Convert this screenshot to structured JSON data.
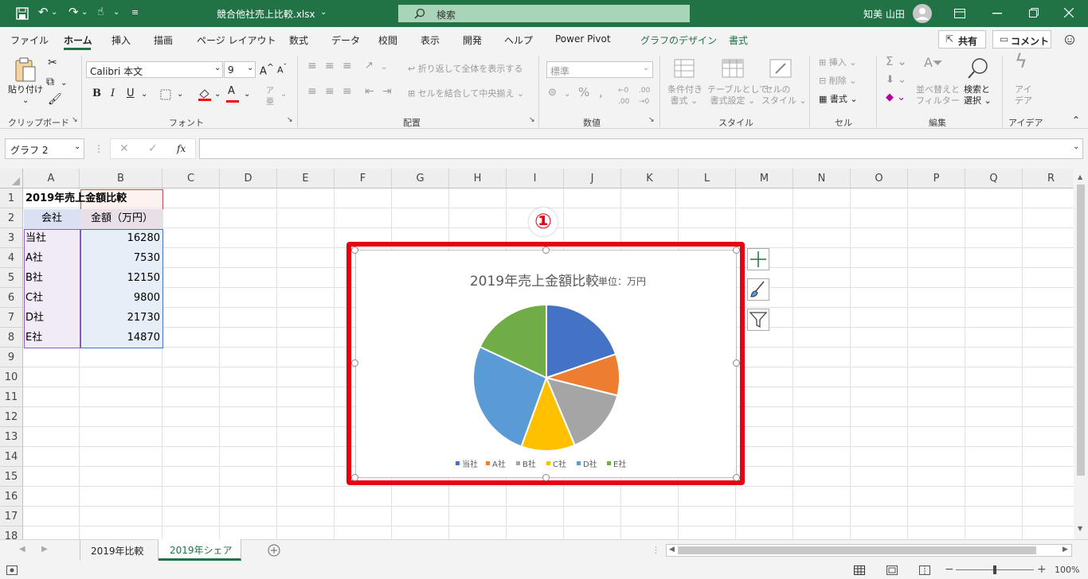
{
  "window": {
    "filename": "競合他社売上比較.xlsx",
    "search_placeholder": "検索",
    "user_name": "知美 山田"
  },
  "menu": {
    "tabs": [
      "ファイル",
      "ホーム",
      "挿入",
      "描画",
      "ページ レイアウト",
      "数式",
      "データ",
      "校閲",
      "表示",
      "開発",
      "ヘルプ",
      "Power Pivot",
      "グラフのデザイン",
      "書式"
    ],
    "share": "共有",
    "comment": "コメント"
  },
  "ribbon": {
    "paste": "貼り付け",
    "font_name": "Calibri 本文",
    "font_size": "9",
    "wrap_text": "折り返して全体を表示する",
    "merge_center": "セルを結合して中央揃え",
    "number_format": "標準",
    "cond_format": [
      "条件付き",
      "書式"
    ],
    "table_format": [
      "テーブルとして",
      "書式設定"
    ],
    "cell_style": [
      "セルの",
      "スタイル"
    ],
    "insert": "挿入",
    "delete": "削除",
    "format": "書式",
    "sort_filter": [
      "並べ替えと",
      "フィルター"
    ],
    "find_select": [
      "検索と",
      "選択"
    ],
    "ideas": [
      "アイ",
      "デア"
    ],
    "groups": {
      "clipboard": "クリップボード",
      "font": "フォント",
      "alignment": "配置",
      "number": "数値",
      "styles": "スタイル",
      "cells": "セル",
      "editing": "編集",
      "ideas": "アイデア"
    }
  },
  "formula_bar": {
    "name_box": "グラフ 2",
    "fx": "fx",
    "formula": ""
  },
  "columns": [
    "A",
    "B",
    "C",
    "D",
    "E",
    "F",
    "G",
    "H",
    "I",
    "J",
    "K",
    "L",
    "M",
    "N",
    "O",
    "P",
    "Q",
    "R"
  ],
  "rows": [
    "1",
    "2",
    "3",
    "4",
    "5",
    "6",
    "7",
    "8",
    "9",
    "10",
    "11",
    "12",
    "13",
    "14",
    "15",
    "16",
    "17",
    "18"
  ],
  "table": {
    "title": "2019年売上金額比較",
    "headers": [
      "会社",
      "金額（万円）"
    ],
    "rows": [
      [
        "当社",
        "16280"
      ],
      [
        "A社",
        "7530"
      ],
      [
        "B社",
        "12150"
      ],
      [
        "C社",
        "9800"
      ],
      [
        "D社",
        "21730"
      ],
      [
        "E社",
        "14870"
      ]
    ]
  },
  "annotation": {
    "marker": "①"
  },
  "chart_data": {
    "type": "pie",
    "title": "2019年売上金額比較",
    "subtitle": "単位：万円",
    "categories": [
      "当社",
      "A社",
      "B社",
      "C社",
      "D社",
      "E社"
    ],
    "values": [
      16280,
      7530,
      12150,
      9800,
      21730,
      14870
    ],
    "colors": [
      "#4472c4",
      "#ed7d31",
      "#a5a5a5",
      "#ffc000",
      "#5b9bd5",
      "#70ad47"
    ],
    "legend": "bottom"
  },
  "sheets": {
    "tabs": [
      "2019年比較",
      "2019年シェア"
    ],
    "active": 1
  },
  "status": {
    "zoom": "100%"
  },
  "accent": "#217346"
}
